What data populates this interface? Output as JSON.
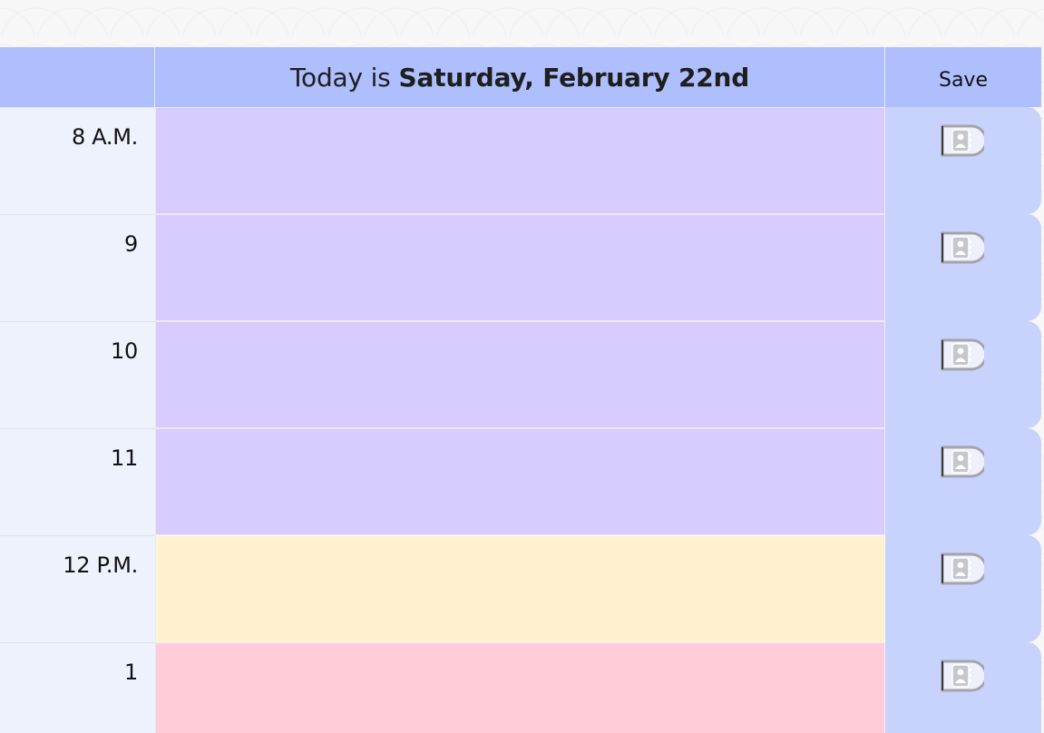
{
  "header": {
    "today_prefix": "Today is",
    "today_date": "Saturday, February 22nd",
    "save_label": "Save"
  },
  "colors": {
    "header_bg": "#afbffd",
    "past": "#d8ccff",
    "present": "#fef2d0",
    "future": "#ffccd8",
    "save_column": "#c7d2fd",
    "hour_column": "#eef2fd"
  },
  "save_icon": "address-book-icon",
  "hours": [
    {
      "label": "8 A.M.",
      "state": "past",
      "task": ""
    },
    {
      "label": "9",
      "state": "past",
      "task": ""
    },
    {
      "label": "10",
      "state": "past",
      "task": ""
    },
    {
      "label": "11",
      "state": "past",
      "task": ""
    },
    {
      "label": "12 P.M.",
      "state": "present",
      "task": ""
    },
    {
      "label": "1",
      "state": "future",
      "task": ""
    }
  ]
}
